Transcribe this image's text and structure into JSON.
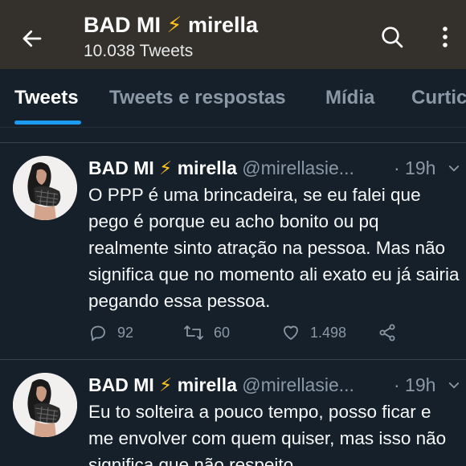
{
  "header": {
    "title": "BAD MI ⚡ mirella",
    "tweet_count": "10.038 Tweets"
  },
  "tabs": [
    {
      "label": "Tweets",
      "active": true
    },
    {
      "label": "Tweets e respostas",
      "active": false
    },
    {
      "label": "Mídia",
      "active": false
    },
    {
      "label": "Curtic",
      "active": false
    }
  ],
  "tweets": [
    {
      "display_name": "BAD MI ⚡ mirella",
      "handle": "@mirellasie...",
      "time": "· 19h",
      "text": "O PPP é uma brincadeira, se eu falei que pego é porque eu acho bonito ou pq realmente sinto atração na pessoa. Mas não significa que no momento ali exato eu já sairia pegando essa pessoa.",
      "replies": "92",
      "retweets": "60",
      "likes": "1.498"
    },
    {
      "display_name": "BAD MI ⚡ mirella",
      "handle": "@mirellasie...",
      "time": "· 19h",
      "text": "Eu to solteira a pouco tempo, posso ficar e me envolver com quem quiser, mas isso não significa que não respeito"
    }
  ],
  "colors": {
    "accent": "#1d9bf0",
    "background": "#15202b",
    "header": "#34302b",
    "muted": "#8b98a5"
  },
  "icons": [
    "back-arrow-icon",
    "search-icon",
    "more-vertical-icon",
    "chevron-down-icon",
    "reply-icon",
    "retweet-icon",
    "like-icon",
    "share-icon"
  ]
}
